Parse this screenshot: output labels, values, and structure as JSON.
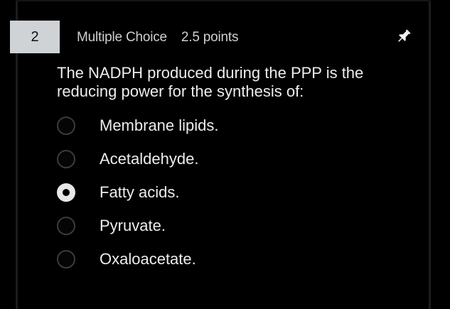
{
  "question": {
    "number": "2",
    "type": "Multiple Choice",
    "points": "2.5 points",
    "text": "The NADPH produced during the PPP is the reducing power for the synthesis of:",
    "options": [
      {
        "label": "Membrane lipids.",
        "selected": false
      },
      {
        "label": "Acetaldehyde.",
        "selected": false
      },
      {
        "label": "Fatty acids.",
        "selected": true
      },
      {
        "label": "Pyruvate.",
        "selected": false
      },
      {
        "label": "Oxaloacetate.",
        "selected": false
      }
    ],
    "pin_icon": "pin-icon"
  }
}
